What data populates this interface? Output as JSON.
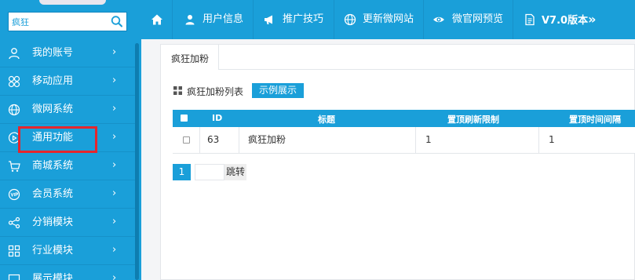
{
  "sidebar": {
    "search": {
      "value": "疯狂",
      "icon": "search-icon"
    },
    "items": [
      {
        "label": "我的账号",
        "icon": "user-icon",
        "arrow": "›"
      },
      {
        "label": "移动应用",
        "icon": "flower-icon",
        "arrow": "›"
      },
      {
        "label": "微网系统",
        "icon": "globe-icon",
        "arrow": "›"
      },
      {
        "label": "通用功能",
        "icon": "play-icon",
        "arrow": "›",
        "highlighted": true
      },
      {
        "label": "商城系统",
        "icon": "cart-icon",
        "arrow": "›"
      },
      {
        "label": "会员系统",
        "icon": "vip-icon",
        "arrow": "›"
      },
      {
        "label": "分销模块",
        "icon": "share-icon",
        "arrow": "›"
      },
      {
        "label": "行业模块",
        "icon": "grid-icon",
        "arrow": "›"
      },
      {
        "label": "展示模块",
        "icon": "display-icon",
        "arrow": "›"
      }
    ]
  },
  "topnav": {
    "items": [
      {
        "label": "",
        "icon": "home-icon"
      },
      {
        "label": "用户信息",
        "icon": "user-icon"
      },
      {
        "label": "推广技巧",
        "icon": "megaphone-icon"
      },
      {
        "label": "更新微网站",
        "icon": "globe-icon"
      },
      {
        "label": "微官网预览",
        "icon": "eye-icon"
      },
      {
        "label": "V7.0版本",
        "icon": "document-icon",
        "suffix": "»"
      }
    ]
  },
  "main": {
    "tab": "疯狂加粉",
    "list_title": "疯狂加粉列表",
    "demo_button": "示例展示",
    "table": {
      "columns": [
        "ID",
        "标题",
        "置顶刷新限制",
        "置顶时间间隔"
      ],
      "rows": [
        {
          "id": "63",
          "title": "疯狂加粉",
          "refresh_limit": "1",
          "interval": "1"
        }
      ]
    },
    "pagination": {
      "current_page": "1",
      "jump_label": "跳转",
      "input_value": ""
    }
  },
  "colors": {
    "primary": "#1a9fd9",
    "highlight_border": "#e5262d",
    "text": "#333333"
  }
}
